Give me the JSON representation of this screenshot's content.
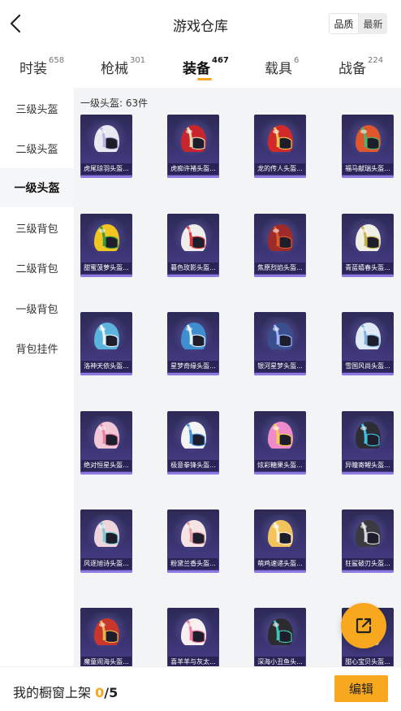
{
  "header": {
    "title": "游戏仓库",
    "sort_options": [
      "品质",
      "最新"
    ],
    "sort_selected": "品质"
  },
  "tabs": [
    {
      "label": "时装",
      "count": "658",
      "active": false
    },
    {
      "label": "枪械",
      "count": "301",
      "active": false
    },
    {
      "label": "装备",
      "count": "467",
      "active": true
    },
    {
      "label": "载具",
      "count": "6",
      "active": false
    },
    {
      "label": "战备",
      "count": "224",
      "active": false
    }
  ],
  "sidebar": {
    "items": [
      {
        "label": "三级头盔",
        "active": false
      },
      {
        "label": "二级头盔",
        "active": false
      },
      {
        "label": "一级头盔",
        "active": true
      },
      {
        "label": "三级背包",
        "active": false
      },
      {
        "label": "二级背包",
        "active": false
      },
      {
        "label": "一级背包",
        "active": false
      },
      {
        "label": "背包挂件",
        "active": false
      }
    ]
  },
  "grid": {
    "title": "一级头盔: 63件",
    "items": [
      {
        "name": "虎尾琼羽头盔...",
        "shell": "#e9e9f2",
        "accent": "#b9b2e0"
      },
      {
        "name": "虎痴许褚头盔...",
        "shell": "#c8262c",
        "accent": "#e6d6b0"
      },
      {
        "name": "龙的传人头盔...",
        "shell": "#d22a2a",
        "accent": "#f2c14e"
      },
      {
        "name": "福马献瑞头盔...",
        "shell": "#e0562c",
        "accent": "#4cb36a"
      },
      {
        "name": "甜蜜菠萝头盔...",
        "shell": "#f3c61f",
        "accent": "#3c9b3c"
      },
      {
        "name": "暮色玫影头盔...",
        "shell": "#f1ecec",
        "accent": "#d63a3a"
      },
      {
        "name": "焦原烈焰头盔...",
        "shell": "#9e2a2a",
        "accent": "#e05a2a"
      },
      {
        "name": "青蓝嬉春头盔...",
        "shell": "#efefe6",
        "accent": "#c9b24a"
      },
      {
        "name": "洛神天依头盔...",
        "shell": "#5ab4de",
        "accent": "#e8f4fb"
      },
      {
        "name": "星梦奇缘头盔...",
        "shell": "#3f8fd0",
        "accent": "#dff1ff"
      },
      {
        "name": "银河星梦头盔...",
        "shell": "#3b4f8f",
        "accent": "#9fb3ff"
      },
      {
        "name": "雪国风尚头盔...",
        "shell": "#dfeaf6",
        "accent": "#7fb3de"
      },
      {
        "name": "绝对恒星头盔...",
        "shell": "#f2c8d6",
        "accent": "#e87fa4"
      },
      {
        "name": "极意拳锋头盔...",
        "shell": "#f3f3f3",
        "accent": "#3d8fd6"
      },
      {
        "name": "炫彩糖果头盔...",
        "shell": "#ef8bc8",
        "accent": "#f6d24c"
      },
      {
        "name": "异瞳寄鲤头盔...",
        "shell": "#2d2d33",
        "accent": "#3ec0e0"
      },
      {
        "name": "风逐旭诗头盔...",
        "shell": "#f0d4dc",
        "accent": "#7cc7d4"
      },
      {
        "name": "粉黛兰香头盔...",
        "shell": "#f6e3e3",
        "accent": "#e3a0aa"
      },
      {
        "name": "萌鸡速递头盔...",
        "shell": "#f4c45c",
        "accent": "#fff2d0"
      },
      {
        "name": "狂鲨破刃头盔...",
        "shell": "#3a3a40",
        "accent": "#d8d8dc"
      },
      {
        "name": "魔童闹海头盔...",
        "shell": "#c8362c",
        "accent": "#e8b24a"
      },
      {
        "name": "喜羊羊与灰太...",
        "shell": "#f8f0f0",
        "accent": "#f07aa0"
      },
      {
        "name": "深海小丑鱼头...",
        "shell": "#2b2b30",
        "accent": "#3fc7b6"
      },
      {
        "name": "甜心宝贝头盔...",
        "shell": "#f2dede",
        "accent": "#e895b4"
      }
    ]
  },
  "share_button": {
    "icon": "share-export-icon",
    "color": "#f7a81e"
  },
  "bottom": {
    "shelf_label": "我的橱窗上架",
    "shelf_current": "0",
    "shelf_total": "/5",
    "edit_label": "编辑"
  }
}
